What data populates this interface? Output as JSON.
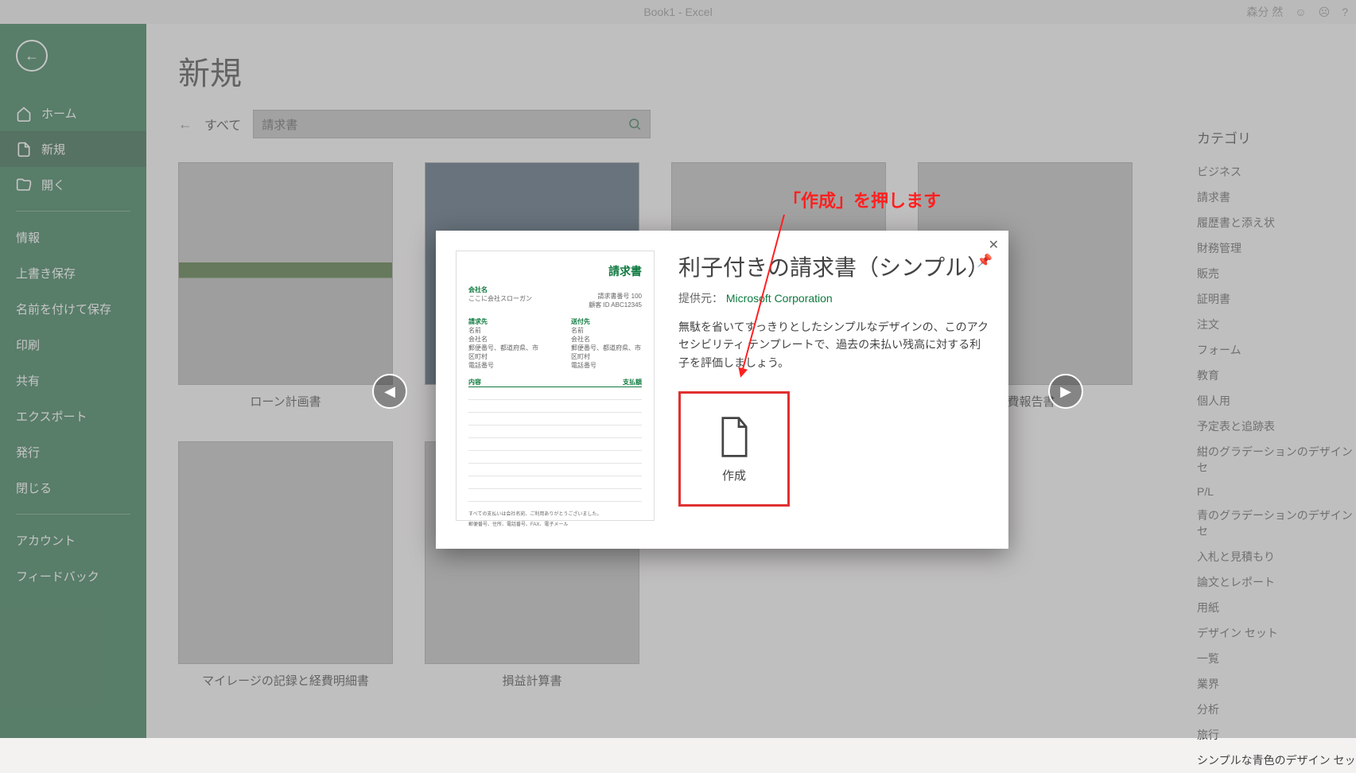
{
  "titlebar": {
    "title": "Book1 - Excel",
    "user": "森分 然",
    "help": "?"
  },
  "sidebar": {
    "nav": [
      {
        "label": "ホーム",
        "icon": "home"
      },
      {
        "label": "新規",
        "icon": "new"
      },
      {
        "label": "開く",
        "icon": "open"
      }
    ],
    "sub": [
      "情報",
      "上書き保存",
      "名前を付けて保存",
      "印刷",
      "共有",
      "エクスポート",
      "発行",
      "閉じる"
    ],
    "footer": [
      "アカウント",
      "フィードバック"
    ]
  },
  "page": {
    "title": "新規",
    "search_all": "すべて",
    "search_value": "請求書"
  },
  "templates": [
    {
      "label": "ローン計画書"
    },
    {
      "label": ""
    },
    {
      "label": ""
    },
    {
      "label": "経費報告書"
    },
    {
      "label": "マイレージの記録と経費明細書"
    },
    {
      "label": "損益計算書"
    }
  ],
  "categories": {
    "heading": "カテゴリ",
    "items": [
      "ビジネス",
      "請求書",
      "履歴書と添え状",
      "財務管理",
      "販売",
      "証明書",
      "注文",
      "フォーム",
      "教育",
      "個人用",
      "予定表と追跡表",
      "紺のグラデーションのデザイン セ",
      "P/L",
      "青のグラデーションのデザイン セ",
      "入札と見積もり",
      "論文とレポート",
      "用紙",
      "デザイン セット",
      "一覧",
      "業界",
      "分析",
      "旅行",
      "シンプルな青色のデザイン セッ"
    ]
  },
  "modal": {
    "title": "利子付きの請求書（シンプル）",
    "provider_label": "提供元：",
    "provider": "Microsoft Corporation",
    "desc": "無駄を省いてすっきりとしたシンプルなデザインの、このアクセシビリティ テンプレートで、過去の未払い残高に対する利子を評価しましょう。",
    "create": "作成",
    "preview": {
      "title": "請求書",
      "company": "会社名",
      "slogan": "ここに会社スローガン",
      "inv_no_lbl": "請求書番号",
      "inv_no": "100",
      "cust_id_lbl": "顧客 ID",
      "cust_id": "ABC12345",
      "bill_to": "請求先",
      "ship_to": "送付先",
      "name": "名前",
      "company_f": "会社名",
      "addr": "郵便番号、都道府県、市区町村",
      "phone": "電話番号",
      "desc_h": "内容",
      "amt_h": "支払額",
      "note": "すべての支払いは会社名宛、ご利用ありがとうございました。",
      "footer": "郵便番号、住所、電話番号、FAX、電子メール"
    }
  },
  "callout": "「作成」を押します"
}
